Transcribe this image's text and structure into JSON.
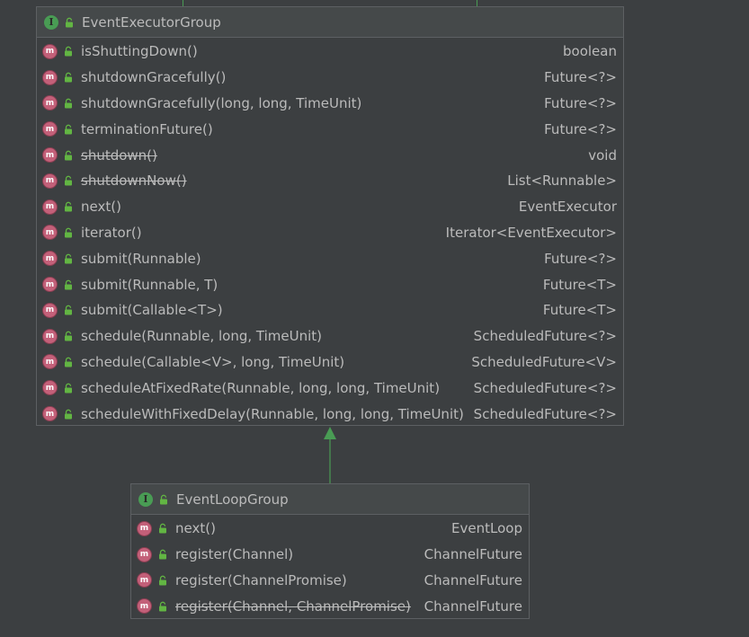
{
  "colors": {
    "background": "#3c3f41",
    "header_background": "#45494a",
    "border": "#5d6063",
    "text": "#bbbbbb",
    "interface_icon": "#499c54",
    "method_icon": "#c36079",
    "inheritance_arrow": "#499c54"
  },
  "icons": {
    "interface": "interface-icon",
    "method": "method-icon",
    "visibility": "public-lock-icon"
  },
  "event_executor_group": {
    "icon_letter": "I",
    "name": "EventExecutorGroup",
    "methods": [
      {
        "icon_letter": "m",
        "signature": "isShuttingDown()",
        "returns": "boolean",
        "deprecated": false
      },
      {
        "icon_letter": "m",
        "signature": "shutdownGracefully()",
        "returns": "Future<?>",
        "deprecated": false
      },
      {
        "icon_letter": "m",
        "signature": "shutdownGracefully(long, long, TimeUnit)",
        "returns": "Future<?>",
        "deprecated": false
      },
      {
        "icon_letter": "m",
        "signature": "terminationFuture()",
        "returns": "Future<?>",
        "deprecated": false
      },
      {
        "icon_letter": "m",
        "signature": "shutdown()",
        "returns": "void",
        "deprecated": true
      },
      {
        "icon_letter": "m",
        "signature": "shutdownNow()",
        "returns": "List<Runnable>",
        "deprecated": true
      },
      {
        "icon_letter": "m",
        "signature": "next()",
        "returns": "EventExecutor",
        "deprecated": false
      },
      {
        "icon_letter": "m",
        "signature": "iterator()",
        "returns": "Iterator<EventExecutor>",
        "deprecated": false
      },
      {
        "icon_letter": "m",
        "signature": "submit(Runnable)",
        "returns": "Future<?>",
        "deprecated": false
      },
      {
        "icon_letter": "m",
        "signature": "submit(Runnable, T)",
        "returns": "Future<T>",
        "deprecated": false
      },
      {
        "icon_letter": "m",
        "signature": "submit(Callable<T>)",
        "returns": "Future<T>",
        "deprecated": false
      },
      {
        "icon_letter": "m",
        "signature": "schedule(Runnable, long, TimeUnit)",
        "returns": "ScheduledFuture<?>",
        "deprecated": false
      },
      {
        "icon_letter": "m",
        "signature": "schedule(Callable<V>, long, TimeUnit)",
        "returns": "ScheduledFuture<V>",
        "deprecated": false
      },
      {
        "icon_letter": "m",
        "signature": "scheduleAtFixedRate(Runnable, long, long, TimeUnit)",
        "returns": "ScheduledFuture<?>",
        "deprecated": false
      },
      {
        "icon_letter": "m",
        "signature": "scheduleWithFixedDelay(Runnable, long, long, TimeUnit)",
        "returns": "ScheduledFuture<?>",
        "deprecated": false
      }
    ]
  },
  "event_loop_group": {
    "icon_letter": "I",
    "name": "EventLoopGroup",
    "methods": [
      {
        "icon_letter": "m",
        "signature": "next()",
        "returns": "EventLoop",
        "deprecated": false
      },
      {
        "icon_letter": "m",
        "signature": "register(Channel)",
        "returns": "ChannelFuture",
        "deprecated": false
      },
      {
        "icon_letter": "m",
        "signature": "register(ChannelPromise)",
        "returns": "ChannelFuture",
        "deprecated": false
      },
      {
        "icon_letter": "m",
        "signature": "register(Channel, ChannelPromise)",
        "returns": "ChannelFuture",
        "deprecated": true
      }
    ]
  }
}
